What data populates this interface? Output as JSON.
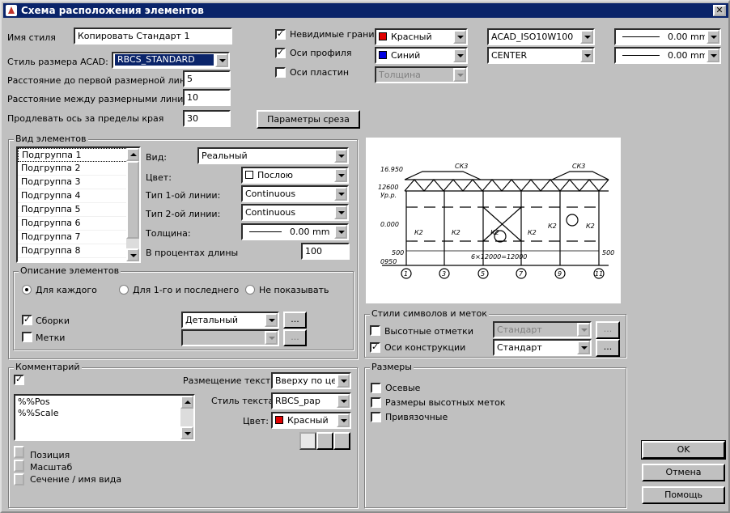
{
  "window": {
    "title": "Схема расположения элементов",
    "close_label": "✕"
  },
  "style": {
    "name_label": "Имя стиля",
    "name_value": "Копировать Стандарт 1",
    "acad_label": "Стиль размера ACAD:",
    "acad_value": "RBCS_STANDARD",
    "dist_first_label": "Расстояние до первой размерной линии",
    "dist_first_value": "5",
    "dist_between_label": "Расстояние между размерными линиями",
    "dist_between_value": "10",
    "extend_label": "Продлевать ось за пределы края",
    "extend_value": "30",
    "section_params_button": "Параметры среза"
  },
  "lines": {
    "hidden_edges": {
      "label": "Невидимые грани",
      "checked": true,
      "color": "Красный",
      "color_hex": "#e00000",
      "linetype": "ACAD_ISO10W100",
      "weight": "0.00 mm"
    },
    "profile_axes": {
      "label": "Оси профиля",
      "checked": true,
      "color": "Синий",
      "color_hex": "#0000e0",
      "linetype": "CENTER",
      "weight": "0.00 mm"
    },
    "plate_axes": {
      "label": "Оси пластин",
      "checked": false,
      "weight_placeholder": "Толщина"
    }
  },
  "view": {
    "group_title": "Вид элементов",
    "subgroups": [
      "Подгруппа 1",
      "Подгруппа 2",
      "Подгруппа 3",
      "Подгруппа 4",
      "Подгруппа 5",
      "Подгруппа 6",
      "Подгруппа 7",
      "Подгруппа 8"
    ],
    "view_label": "Вид:",
    "view_value": "Реальный",
    "color_label": "Цвет:",
    "color_value": "Послою",
    "line1_label": "Тип 1-ой линии:",
    "line1_value": "Continuous",
    "line2_label": "Тип 2-ой линии:",
    "line2_value": "Continuous",
    "thickness_label": "Толщина:",
    "thickness_value": "0.00 mm",
    "percent_label": "В процентах длины",
    "percent_value": "100"
  },
  "description": {
    "group_title": "Описание элементов",
    "radio_each": "Для каждого",
    "radio_first_last": "Для 1-го и последнего",
    "radio_none": "Не показывать",
    "assemblies_label": "Сборки",
    "assemblies_value": "Детальный",
    "marks_label": "Метки",
    "ellipsis": "..."
  },
  "comment": {
    "group_title": "Комментарий",
    "text_lines": [
      "%%Pos",
      "%%Scale"
    ],
    "placement_label": "Размещение текста",
    "placement_value": "Вверху по центру",
    "text_style_label": "Стиль текста",
    "text_style_value": "RBCS_pap",
    "color_label": "Цвет:",
    "color_value": "Красный",
    "color_hex": "#e00000",
    "btn_position": "Позиция",
    "btn_scale": "Масштаб",
    "btn_section": "Сечение / имя вида"
  },
  "symbols": {
    "group_title": "Стили символов и меток",
    "elevation_label": "Высотные отметки",
    "elevation_value": "Стандарт",
    "axes_label": "Оси конструкции",
    "axes_value": "Стандарт",
    "ellipsis": "..."
  },
  "dimensions": {
    "group_title": "Размеры",
    "axial": "Осевые",
    "elevation": "Размеры высотных меток",
    "binding": "Привязочные"
  },
  "buttons": {
    "ok": "OK",
    "cancel": "Отмена",
    "help": "Помощь"
  },
  "drawing": {
    "labels": [
      "СК3",
      "СК3",
      "16.950",
      "12600",
      "Ур.р.",
      "0.000",
      "0950",
      "500",
      "500",
      "К2",
      "К2",
      "К2",
      "К2",
      "К2",
      "К2",
      "6×12000=12000",
      "1",
      "3",
      "5",
      "7",
      "9",
      "11"
    ]
  }
}
